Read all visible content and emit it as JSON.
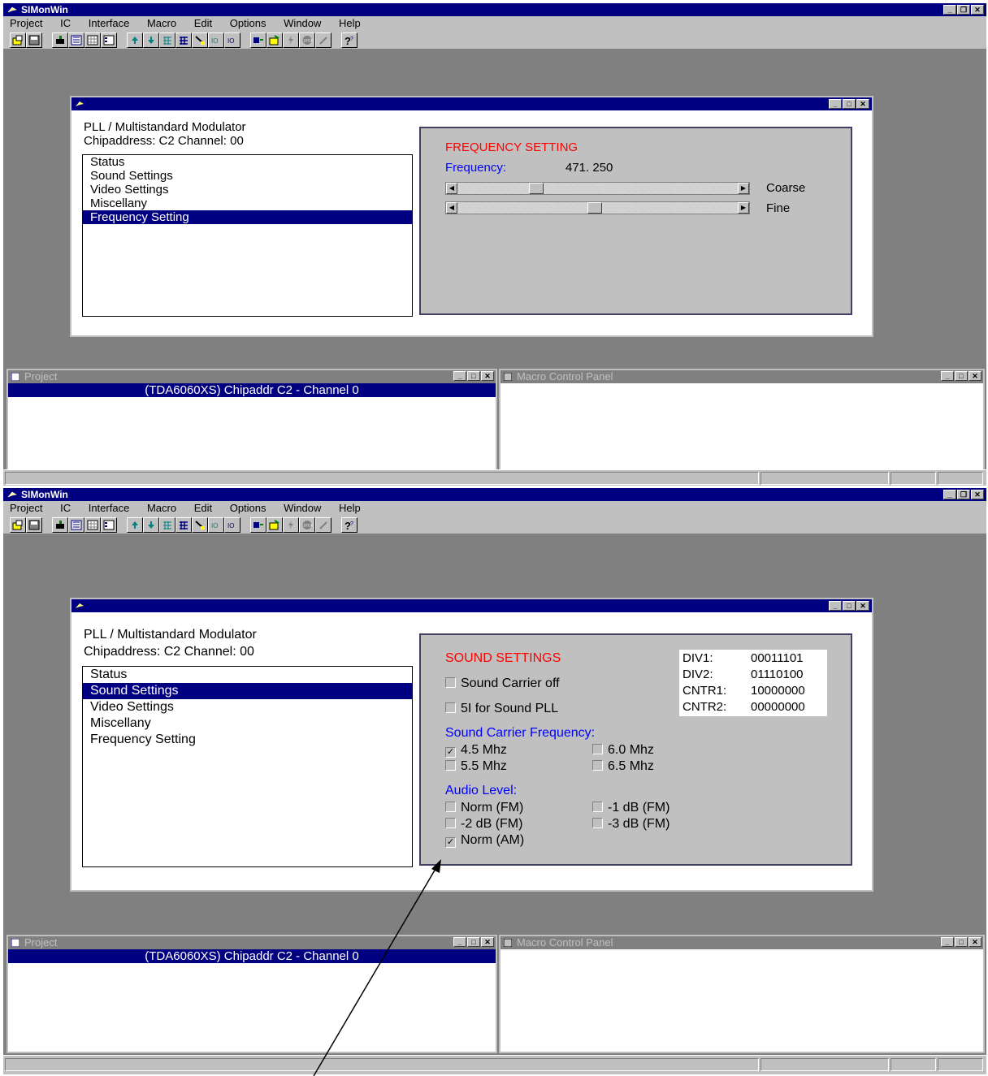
{
  "app": {
    "title": "SIMonWin"
  },
  "menu": [
    "Project",
    "IC",
    "Interface",
    "Macro",
    "Edit",
    "Options",
    "Window",
    "Help"
  ],
  "child": {
    "heading1": "PLL / Multistandard Modulator",
    "heading2": "Chipaddress: C2  Channel: 00",
    "tree": [
      "Status",
      "Sound Settings",
      "Video Settings",
      "Miscellany",
      "Frequency Setting"
    ]
  },
  "freq_panel": {
    "title": "FREQUENCY SETTING",
    "freq_label": "Frequency:",
    "freq_value": "471. 250",
    "coarse_label": "Coarse",
    "fine_label": "Fine",
    "coarse_position": 0.27,
    "fine_position": 0.49
  },
  "sound_panel": {
    "title": "SOUND SETTINGS",
    "sound_carrier_off": {
      "label": "Sound Carrier off",
      "checked": false
    },
    "si_sound_pll": {
      "label": "5I for Sound PLL",
      "checked": false
    },
    "carrier_freq_label": "Sound Carrier Frequency:",
    "carrier_options": [
      {
        "label": "4.5 Mhz",
        "checked": true
      },
      {
        "label": "6.0 Mhz",
        "checked": false
      },
      {
        "label": "5.5 Mhz",
        "checked": false
      },
      {
        "label": "6.5 Mhz",
        "checked": false
      }
    ],
    "audio_level_label": "Audio Level:",
    "audio_options": [
      {
        "label": "Norm (FM)",
        "checked": false
      },
      {
        "label": "-1 dB (FM)",
        "checked": false
      },
      {
        "label": "-2 dB (FM)",
        "checked": false
      },
      {
        "label": "-3 dB (FM)",
        "checked": false
      },
      {
        "label": "Norm (AM)",
        "checked": true
      }
    ],
    "registers": [
      {
        "name": "DIV1:",
        "value": "00011101"
      },
      {
        "name": "DIV2:",
        "value": "01110100"
      },
      {
        "name": "CNTR1:",
        "value": "10000000"
      },
      {
        "name": "CNTR2:",
        "value": "00000000"
      }
    ]
  },
  "project_window": {
    "title": "Project",
    "row": "(TDA6060XS)  Chipaddr C2 - Channel 0"
  },
  "macro_window": {
    "title": "Macro Control Panel"
  },
  "controls": {
    "minimize": "_",
    "maximize": "□",
    "restore": "❐",
    "close": "✕"
  },
  "checkmark": "✓"
}
